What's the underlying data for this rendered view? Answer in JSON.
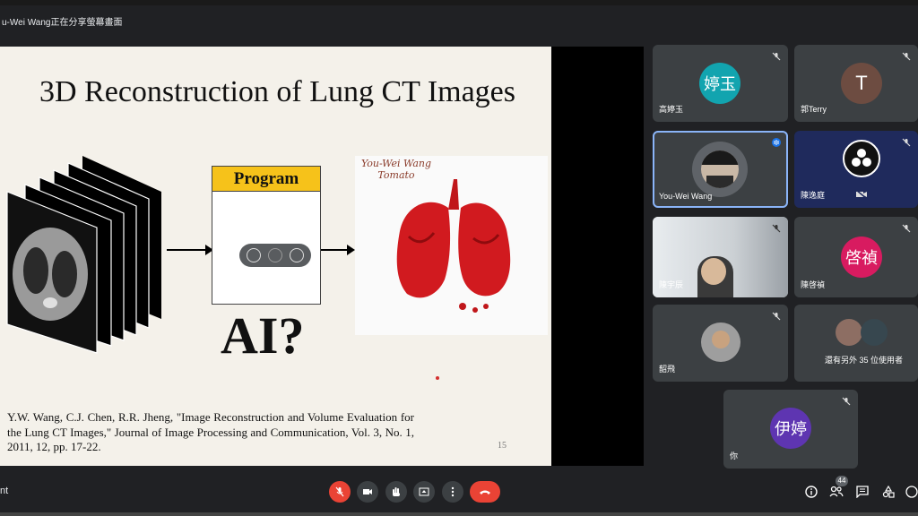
{
  "banner": {
    "text": "u-Wei Wang正在分享螢幕畫面"
  },
  "slide": {
    "title": "3D Reconstruction of Lung CT Images",
    "program_label": "Program",
    "ai_label": "AI?",
    "lung_caption": "You-Wei Wang Tomato",
    "citation": "Y.W. Wang, C.J. Chen, R.R. Jheng, \"Image Reconstruction and Volume Evaluation for the Lung CT Images,\" Journal of Image Processing and Communication, Vol. 3, No. 1, 2011, 12, pp. 17-22.",
    "page_number": "15"
  },
  "participants": [
    {
      "name": "高婷玉",
      "avatar_text": "婷玉",
      "avatar_color": "#12a4af",
      "muted": true
    },
    {
      "name": "郭Terry",
      "avatar_text": "T",
      "avatar_color": "#6d4c41",
      "muted": true
    },
    {
      "name": "You-Wei Wang",
      "avatar_text": "",
      "avatar_color": "#555",
      "speaking": true
    },
    {
      "name": "陳逸庭",
      "avatar_text": "",
      "avatar_color": "#222",
      "muted": true
    },
    {
      "name": "陳宇辰",
      "avatar_text": "",
      "avatar_color": "#888",
      "muted": true
    },
    {
      "name": "陳啓禎",
      "avatar_text": "啓禎",
      "avatar_color": "#d81b60",
      "muted": true
    },
    {
      "name": "韶飛",
      "avatar_text": "",
      "avatar_color": "#888",
      "muted": true
    },
    {
      "name": "還有另外 35 位使用者",
      "avatar_text": "",
      "avatar_color": "#888"
    },
    {
      "name": "你",
      "avatar_text": "伊婷",
      "avatar_color": "#5e35b1",
      "muted": true
    }
  ],
  "bottombar": {
    "left_label": "nt",
    "participant_count": "44"
  },
  "colors": {
    "accent": "#8ab4f8",
    "danger": "#ea4335",
    "program_yellow": "#f6c21a"
  }
}
